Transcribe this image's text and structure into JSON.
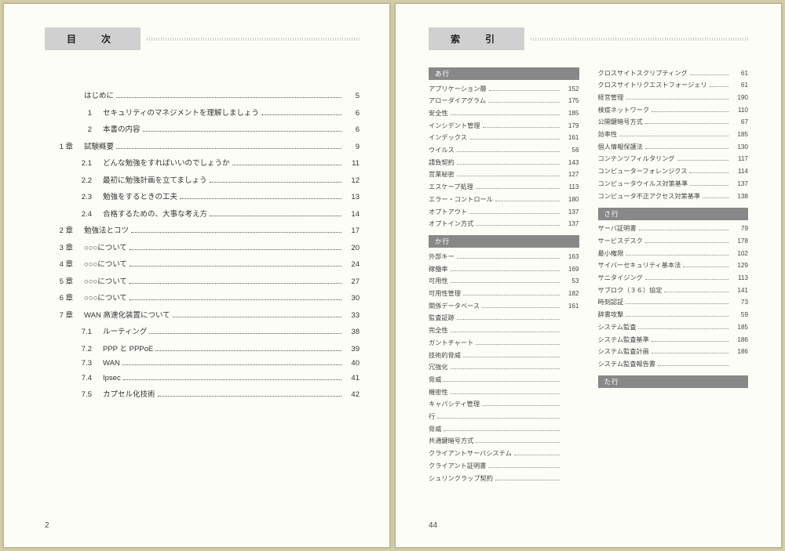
{
  "left_page": {
    "title": "目　次",
    "page_number": "2",
    "toc": [
      {
        "num": "",
        "label": "はじめに",
        "page": "5",
        "level": 0
      },
      {
        "num": "1",
        "label": "セキュリティのマネジメントを理解しましょう",
        "page": "6",
        "level": 1
      },
      {
        "num": "2",
        "label": "本書の内容",
        "page": "6",
        "level": 1
      },
      {
        "num": "1 章",
        "label": "試験概要",
        "page": "9",
        "level": 0
      },
      {
        "num": "2.1",
        "label": "どんな勉強をすればいいのでしょうか",
        "page": "11",
        "level": 1
      },
      {
        "num": "2.2",
        "label": "最初に勉強計画を立てましょう",
        "page": "12",
        "level": 1
      },
      {
        "num": "2.3",
        "label": "勉強をするときの工夫",
        "page": "13",
        "level": 1
      },
      {
        "num": "2.4",
        "label": "合格するための、大事な考え方",
        "page": "14",
        "level": 1
      },
      {
        "num": "2 章",
        "label": "勉強法とコツ",
        "page": "17",
        "level": 0
      },
      {
        "num": "3 章",
        "label": "○○○について",
        "page": "20",
        "level": 0
      },
      {
        "num": "4 章",
        "label": "○○○について",
        "page": "24",
        "level": 0
      },
      {
        "num": "5 章",
        "label": "○○○について",
        "page": "27",
        "level": 0
      },
      {
        "num": "6 章",
        "label": "○○○について",
        "page": "30",
        "level": 0
      },
      {
        "num": "7 章",
        "label": "WAN 高速化装置について",
        "page": "33",
        "level": 0
      },
      {
        "num": "7.1",
        "label": "ルーティング",
        "page": "38",
        "level": 1
      },
      {
        "num": "7.2",
        "label": "PPP と PPPoE",
        "page": "39",
        "level": 1
      },
      {
        "num": "7.3",
        "label": "WAN",
        "page": "40",
        "level": 1
      },
      {
        "num": "7.4",
        "label": "Ipsec",
        "page": "41",
        "level": 1
      },
      {
        "num": "7.5",
        "label": "カプセル化技術",
        "page": "42",
        "level": 1
      }
    ]
  },
  "right_page": {
    "title": "索　引",
    "page_number": "44",
    "columns": [
      [
        {
          "head": "あ行",
          "items": [
            {
              "term": "アプリケーション層",
              "page": "152"
            },
            {
              "term": "アローダイアグラム",
              "page": "175"
            },
            {
              "term": "安全性",
              "page": "185"
            },
            {
              "term": "インシデント管理",
              "page": "179"
            },
            {
              "term": "インデックス",
              "page": "161"
            },
            {
              "term": "ウイルス",
              "page": "56"
            },
            {
              "term": "請負契約",
              "page": "143"
            },
            {
              "term": "営業秘密",
              "page": "127"
            },
            {
              "term": "エスケープ処理",
              "page": "113"
            },
            {
              "term": "エラー・コントロール",
              "page": "180"
            },
            {
              "term": "オプトアウト",
              "page": "137"
            },
            {
              "term": "オプトイン方式",
              "page": "137"
            }
          ]
        },
        {
          "head": "か行",
          "items": [
            {
              "term": "外部キー",
              "page": "163"
            },
            {
              "term": "稼働率",
              "page": "169"
            },
            {
              "term": "可用性",
              "page": "53"
            },
            {
              "term": "可用性管理",
              "page": "182"
            },
            {
              "term": "関係データベース",
              "page": "161"
            },
            {
              "term": "監査証跡",
              "page": ""
            },
            {
              "term": "完全性",
              "page": ""
            },
            {
              "term": "ガントチャート",
              "page": ""
            },
            {
              "term": "技術的脅威",
              "page": ""
            },
            {
              "term": "冗強化",
              "page": ""
            },
            {
              "term": "脅威",
              "page": ""
            },
            {
              "term": "機密性",
              "page": ""
            },
            {
              "term": "キャパシティ管理",
              "page": ""
            },
            {
              "term": "行",
              "page": ""
            },
            {
              "term": "脅威",
              "page": ""
            },
            {
              "term": "共通鍵暗号方式",
              "page": ""
            },
            {
              "term": "クライアントサーバシステム",
              "page": ""
            },
            {
              "term": "クライアント証明書",
              "page": ""
            },
            {
              "term": "シュリンクラップ契約",
              "page": ""
            }
          ]
        }
      ],
      [
        {
          "head": null,
          "items": [
            {
              "term": "クロスサイトスクリプティング",
              "page": "61"
            },
            {
              "term": "クロスサイトリクエストフォージェリ",
              "page": "61"
            },
            {
              "term": "経営管理",
              "page": "190"
            },
            {
              "term": "検疫ネットワーク",
              "page": "110"
            },
            {
              "term": "公開鍵暗号方式",
              "page": "67"
            },
            {
              "term": "効率性",
              "page": "185"
            },
            {
              "term": "個人情報保護法",
              "page": "130"
            },
            {
              "term": "コンテンツフィルタリング",
              "page": "117"
            },
            {
              "term": "コンピューターフォレンジクス",
              "page": "114"
            },
            {
              "term": "コンピュータウイルス対策基準",
              "page": "137"
            },
            {
              "term": "コンピュータ不正アクセス対策基準",
              "page": "138"
            }
          ]
        },
        {
          "head": "さ行",
          "items": [
            {
              "term": "サーバ証明書",
              "page": "79"
            },
            {
              "term": "サービスデスク",
              "page": "178"
            },
            {
              "term": "最小権限",
              "page": "102"
            },
            {
              "term": "サイバーセキュリティ基本法",
              "page": "129"
            },
            {
              "term": "サニタイジング",
              "page": "113"
            },
            {
              "term": "サブロク（３６）協定",
              "page": "141"
            },
            {
              "term": "時刻認証",
              "page": "73"
            },
            {
              "term": "辞書攻撃",
              "page": "59"
            },
            {
              "term": "システム監査",
              "page": "185"
            },
            {
              "term": "システム監査基準",
              "page": "186"
            },
            {
              "term": "システム監査計画",
              "page": "186"
            },
            {
              "term": "システム監査報告書",
              "page": ""
            }
          ]
        },
        {
          "head": "た行",
          "items": []
        }
      ]
    ]
  }
}
